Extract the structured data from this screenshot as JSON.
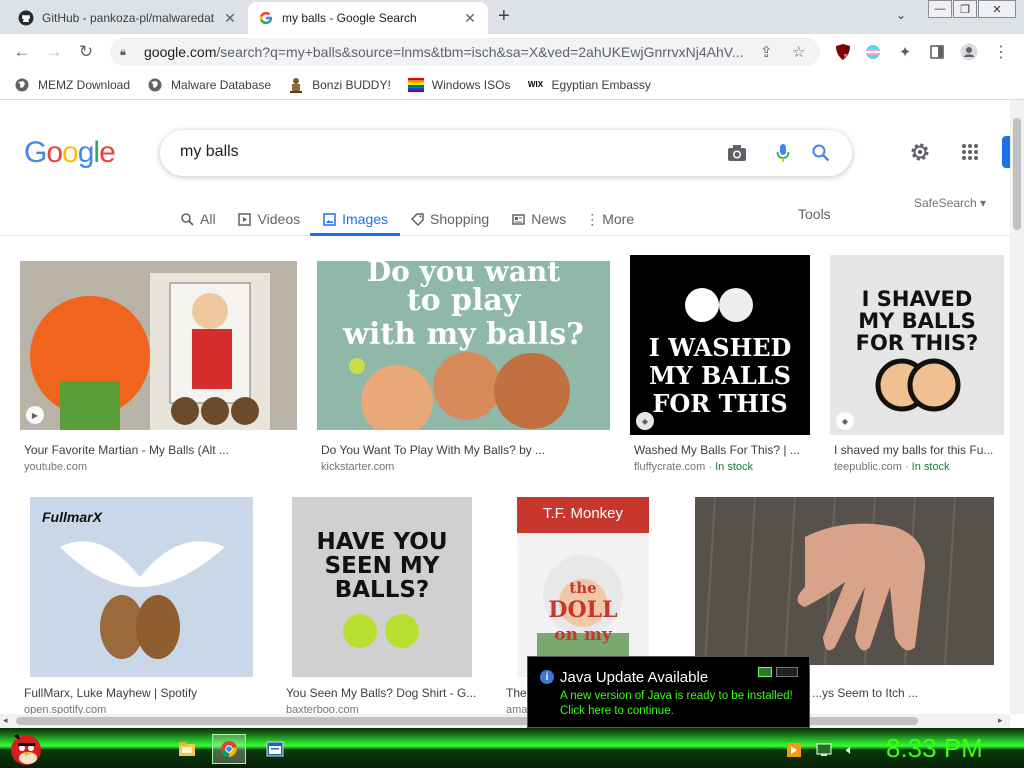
{
  "browser": {
    "tabs": [
      {
        "title": "GitHub - pankoza-pl/malwaredat",
        "active": false
      },
      {
        "title": "my balls - Google Search",
        "active": true
      }
    ],
    "new_tab": "+",
    "tab_search": "⌄",
    "window_controls": {
      "minimize": "—",
      "restore": "❐",
      "close": "✕"
    },
    "url_host": "google.com",
    "url_rest": "/search?q=my+balls&source=lnms&tbm=isch&sa=X&ved=2ahUKEwjGnrrvxNj4AhV...",
    "extension_badge": "5",
    "bookmarks": [
      "MEMZ Download",
      "Malware Database",
      "Bonzi BUDDY!",
      "Windows ISOs",
      "Egyptian Embassy"
    ]
  },
  "google": {
    "logo_letters": [
      "G",
      "o",
      "o",
      "g",
      "l",
      "e"
    ],
    "logo_colors": [
      "#4285f4",
      "#ea4335",
      "#fbbc05",
      "#4285f4",
      "#34a853",
      "#ea4335"
    ],
    "query": "my balls",
    "tabs": [
      "All",
      "Videos",
      "Images",
      "Shopping",
      "News",
      "More"
    ],
    "active_tab": "Images",
    "tools": "Tools",
    "safesearch": "SafeSearch ▾"
  },
  "results": [
    {
      "caption": "Your Favorite Martian - My Balls (Alt ...",
      "source": "youtube.com",
      "stock": ""
    },
    {
      "caption": "Do You Want To Play With My Balls? by ...",
      "source": "kickstarter.com",
      "stock": "",
      "img_text1": "Do you want",
      "img_text2": "to play",
      "img_text3": "with my balls?"
    },
    {
      "caption": "Washed My Balls For This? | ...",
      "source": "fluffycrate.com · ",
      "stock": "In stock",
      "img_text1": "I WASHED",
      "img_text2": "MY BALLS",
      "img_text3": "FOR THIS"
    },
    {
      "caption": "I shaved my balls for this Fu...",
      "source": "teepublic.com · ",
      "stock": "In stock",
      "img_text1": "I SHAVED",
      "img_text2": "MY BALLS",
      "img_text3": "FOR THIS?"
    },
    {
      "caption": "FullMarx, Luke Mayhew | Spotify",
      "source": "open.spotify.com",
      "stock": "",
      "img_text1": "FullmarX"
    },
    {
      "caption": "You Seen My Balls? Dog Shirt - G...",
      "source": "baxterboo.com",
      "stock": "",
      "img_text1": "HAVE YOU",
      "img_text2": "SEEN MY",
      "img_text3": "BALLS?"
    },
    {
      "caption": "The ...",
      "source": "ama...",
      "stock": "",
      "img_text1": "T.F. Monkey",
      "img_text2": "the",
      "img_text3": "DOLL",
      "img_text4": "on my"
    },
    {
      "caption": "...ys Seem to Itch ...",
      "source": "",
      "stock": ""
    }
  ],
  "java_popup": {
    "title": "Java Update Available",
    "line1": "A new version of Java is ready to be installed!",
    "line2": "Click here to continue."
  },
  "taskbar": {
    "clock": "8:33 PM"
  }
}
